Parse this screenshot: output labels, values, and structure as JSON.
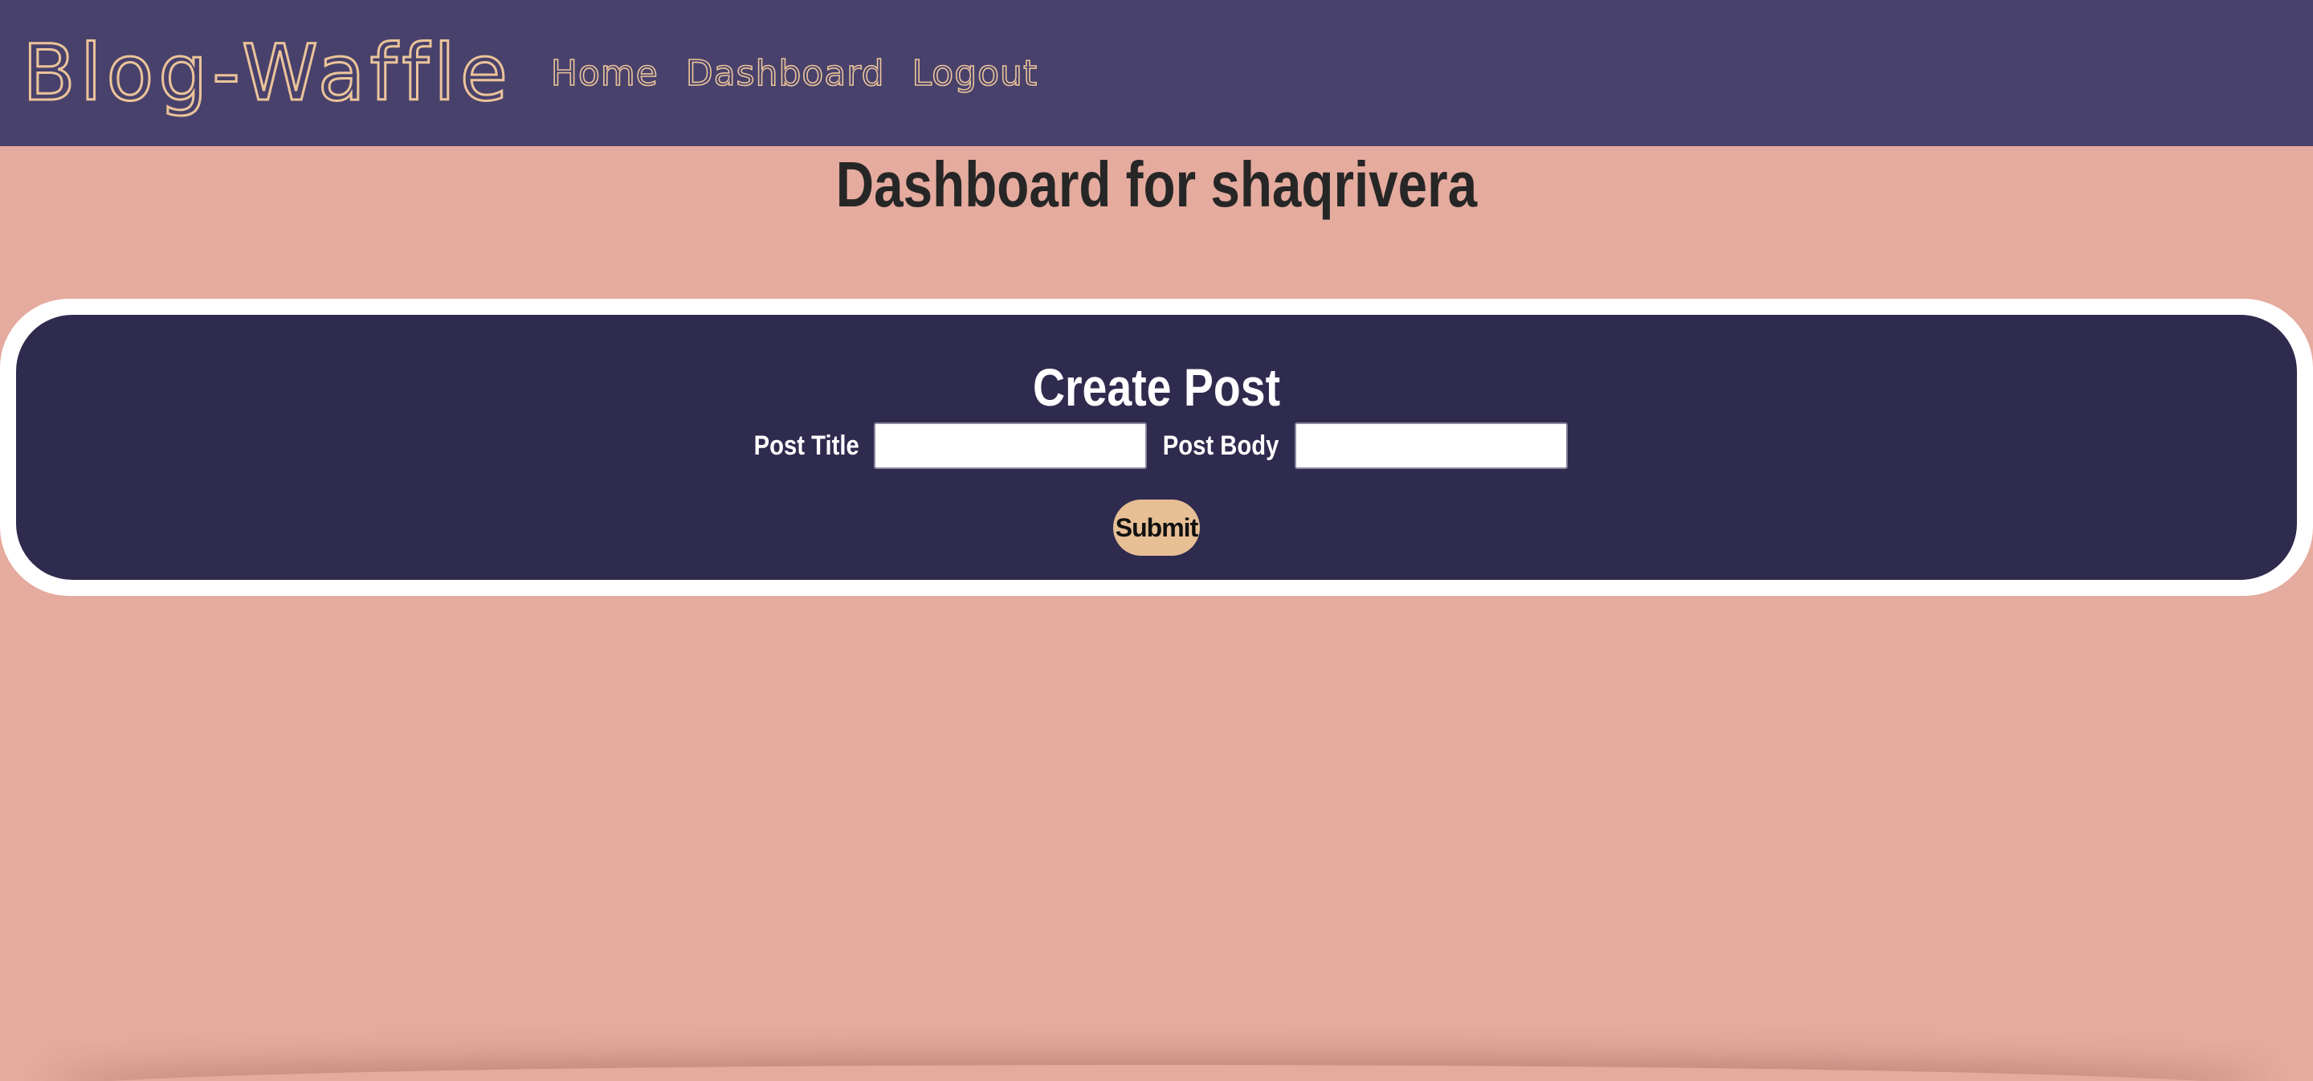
{
  "header": {
    "brand": "Blog-Waffle",
    "nav": [
      {
        "label": "Home"
      },
      {
        "label": "Dashboard"
      },
      {
        "label": "Logout"
      }
    ]
  },
  "main": {
    "page_title": "Dashboard for shaqrivera",
    "create_post": {
      "title": "Create Post",
      "post_title_label": "Post Title",
      "post_title_value": "",
      "post_body_label": "Post Body",
      "post_body_value": "",
      "submit_label": "Submit"
    }
  },
  "colors": {
    "navbar_bg": "#48416b",
    "page_bg": "#e5ab9e",
    "card_bg": "#2f2b4e",
    "accent": "#ecc49a",
    "submit_bg": "#e7bf95"
  }
}
